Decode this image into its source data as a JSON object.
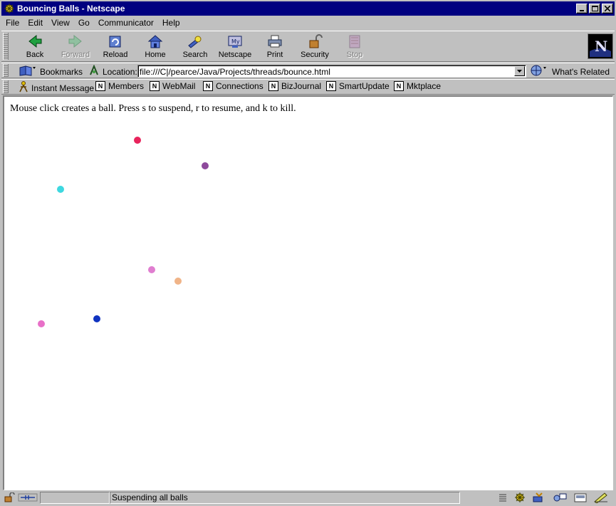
{
  "window": {
    "title": "Bouncing Balls - Netscape"
  },
  "menu": [
    {
      "label": "File"
    },
    {
      "label": "Edit"
    },
    {
      "label": "View"
    },
    {
      "label": "Go"
    },
    {
      "label": "Communicator"
    },
    {
      "label": "Help"
    }
  ],
  "toolbar": {
    "back": "Back",
    "forward": "Forward",
    "reload": "Reload",
    "home": "Home",
    "search": "Search",
    "netscape": "Netscape",
    "print": "Print",
    "security": "Security",
    "stop": "Stop"
  },
  "location": {
    "bookmarks": "Bookmarks",
    "label": "Location:",
    "url": "file:///C|/pearce/Java/Projects/threads/bounce.html",
    "whats_related": "What's Related"
  },
  "personal": [
    {
      "label": "Instant Message"
    },
    {
      "label": "Members"
    },
    {
      "label": "WebMail"
    },
    {
      "label": "Connections"
    },
    {
      "label": "BizJournal"
    },
    {
      "label": "SmartUpdate"
    },
    {
      "label": "Mktplace"
    }
  ],
  "content": {
    "instruction": "Mouse click creates a ball. Press s to suspend, r to resume, and k to kill."
  },
  "status": {
    "text": "Suspending all balls"
  },
  "colors": {
    "titlebar": "#000080",
    "ball_colors": [
      "#e8245c",
      "#8e4a9c",
      "#3ed8e0",
      "#e07ed0",
      "#f0b488",
      "#1033c0",
      "#e870c8"
    ]
  }
}
